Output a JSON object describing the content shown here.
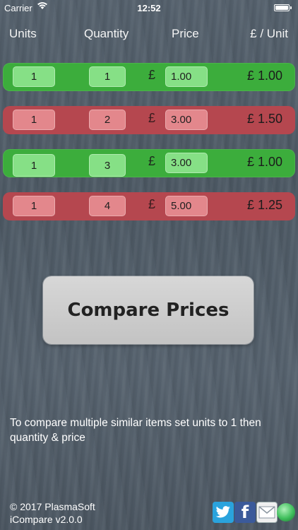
{
  "status_bar": {
    "carrier": "Carrier",
    "time": "12:52"
  },
  "header": {
    "units": "Units",
    "quantity": "Quantity",
    "price": "Price",
    "per_unit": "£ / Unit"
  },
  "rows": [
    {
      "units": "1",
      "quantity": "1",
      "currency": "£",
      "price": "1.00",
      "per_unit": "£ 1.00",
      "state": "green"
    },
    {
      "units": "1",
      "quantity": "2",
      "currency": "£",
      "price": "3.00",
      "per_unit": "£ 1.50",
      "state": "red"
    },
    {
      "units": "1",
      "quantity": "3",
      "currency": "£",
      "price": "3.00",
      "per_unit": "£ 1.00",
      "state": "green"
    },
    {
      "units": "1",
      "quantity": "4",
      "currency": "£",
      "price": "5.00",
      "per_unit": "£ 1.25",
      "state": "red"
    }
  ],
  "compare_button": "Compare Prices",
  "hint": "To compare multiple similar items set units to 1 then quantity & price",
  "footer": {
    "copyright": "© 2017 PlasmaSoft",
    "version": "iCompare v2.0.0"
  },
  "share_icons": [
    "twitter-icon",
    "facebook-icon",
    "mail-icon",
    "globe-icon"
  ],
  "colors": {
    "green_row": "#3cad3c",
    "red_row": "#b5474f"
  }
}
